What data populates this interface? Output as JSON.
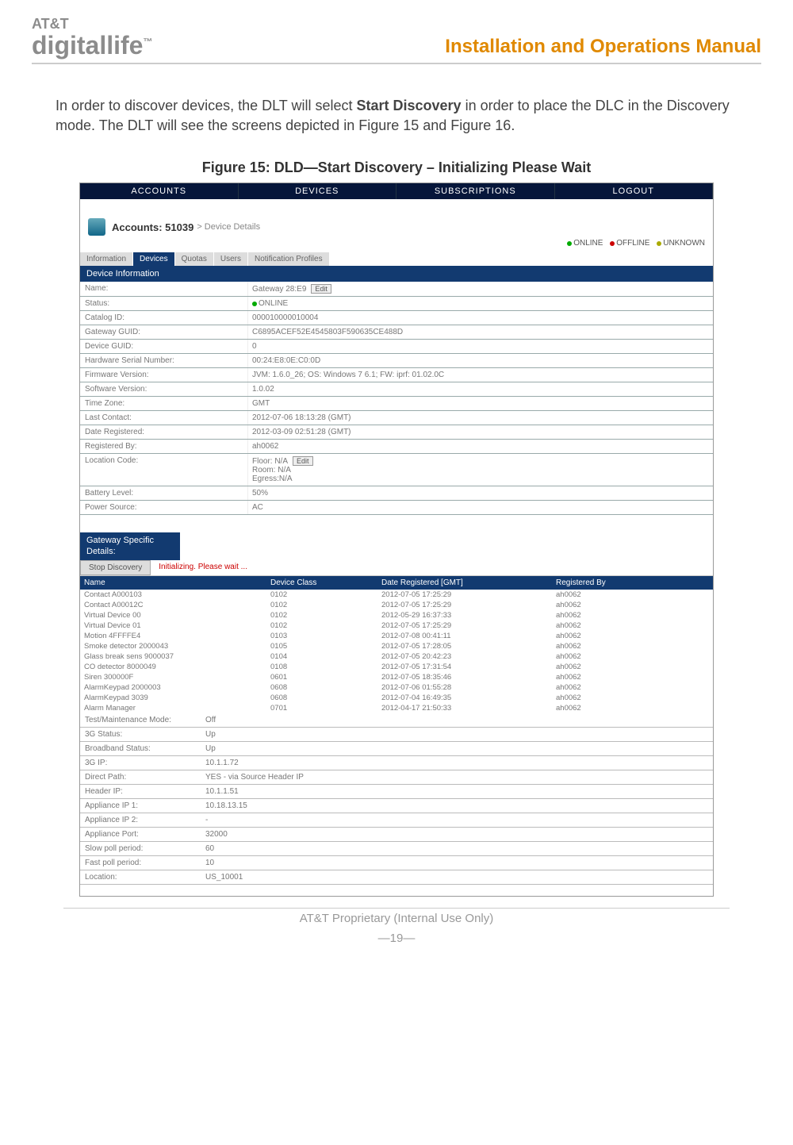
{
  "header": {
    "brand_top": "AT&T",
    "brand_main": "digitallife",
    "tm": "™",
    "doc_title": "Installation and Operations Manual"
  },
  "body": {
    "para_a": "In order to discover devices, the DLT will select ",
    "para_bold": "Start Discovery",
    "para_b": " in order to place the DLC in the Discovery mode. The DLT will see the screens depicted in Figure 15 and Figure 16."
  },
  "figure_caption": "Figure 15:  DLD—Start Discovery – Initializing Please Wait",
  "nav": {
    "accounts": "ACCOUNTS",
    "devices": "DEVICES",
    "subscriptions": "SUBSCRIPTIONS",
    "logout": "LOGOUT"
  },
  "subheader": {
    "label": "Accounts: 51039",
    "crumb": "> Device Details"
  },
  "status_legend": {
    "online": "ONLINE",
    "offline": "OFFLINE",
    "unknown": "UNKNOWN"
  },
  "tabs": {
    "information": "Information",
    "devices": "Devices",
    "quotas": "Quotas",
    "users": "Users",
    "notif": "Notification Profiles"
  },
  "section_device_info": "Device Information",
  "dev_rows": [
    {
      "label": "Name:",
      "value": "Gateway 28:E9",
      "edit": "Edit"
    },
    {
      "label": "Status:",
      "value": "ONLINE",
      "dot": true
    },
    {
      "label": "Catalog ID:",
      "value": "000010000010004"
    },
    {
      "label": "Gateway GUID:",
      "value": "C6895ACEF52E4545803F590635CE488D"
    },
    {
      "label": "Device GUID:",
      "value": "0"
    },
    {
      "label": "Hardware Serial Number:",
      "value": "00:24:E8:0E:C0:0D"
    },
    {
      "label": "Firmware Version:",
      "value": "JVM: 1.6.0_26; OS: Windows 7 6.1; FW: iprf: 01.02.0C"
    },
    {
      "label": "Software Version:",
      "value": "1.0.02"
    },
    {
      "label": "Time Zone:",
      "value": "GMT"
    },
    {
      "label": "Last Contact:",
      "value": "2012-07-06 18:13:28 (GMT)"
    },
    {
      "label": "Date Registered:",
      "value": "2012-03-09 02:51:28 (GMT)"
    },
    {
      "label": "Registered By:",
      "value": "ah0062"
    },
    {
      "label": "Location Code:",
      "value": "Floor:  N/A     Edit\nRoom:  N/A\nEgress:N/A",
      "edit": "Edit",
      "multi": true,
      "lines": [
        "Floor:  N/A",
        "Room:  N/A",
        "Egress:N/A"
      ]
    },
    {
      "label": "Battery Level:",
      "value": "50%"
    },
    {
      "label": "Power Source:",
      "value": "AC"
    }
  ],
  "section_gw": "Gateway Specific Details:",
  "stop_discovery": "Stop Discovery",
  "init_msg": "Initializing. Please wait ...",
  "table_head": {
    "name": "Name",
    "dclass": "Device Class",
    "date": "Date Registered [GMT]",
    "by": "Registered By"
  },
  "devices": [
    {
      "name": "Contact A000103",
      "dclass": "0102",
      "date": "2012-07-05 17:25:29",
      "by": "ah0062"
    },
    {
      "name": "Contact A00012C",
      "dclass": "0102",
      "date": "2012-07-05 17:25:29",
      "by": "ah0062"
    },
    {
      "name": "Virtual Device 00",
      "dclass": "0102",
      "date": "2012-05-29 16:37:33",
      "by": "ah0062"
    },
    {
      "name": "Virtual Device 01",
      "dclass": "0102",
      "date": "2012-07-05 17:25:29",
      "by": "ah0062"
    },
    {
      "name": "Motion 4FFFFE4",
      "dclass": "0103",
      "date": "2012-07-08 00:41:11",
      "by": "ah0062"
    },
    {
      "name": "Smoke detector 2000043",
      "dclass": "0105",
      "date": "2012-07-05 17:28:05",
      "by": "ah0062"
    },
    {
      "name": "Glass break sens 9000037",
      "dclass": "0104",
      "date": "2012-07-05 20:42:23",
      "by": "ah0062"
    },
    {
      "name": "CO detector 8000049",
      "dclass": "0108",
      "date": "2012-07-05 17:31:54",
      "by": "ah0062"
    },
    {
      "name": "Siren 300000F",
      "dclass": "0601",
      "date": "2012-07-05 18:35:46",
      "by": "ah0062"
    },
    {
      "name": "AlarmKeypad 2000003",
      "dclass": "0608",
      "date": "2012-07-06 01:55:28",
      "by": "ah0062"
    },
    {
      "name": "AlarmKeypad 3039",
      "dclass": "0608",
      "date": "2012-07-04 16:49:35",
      "by": "ah0062"
    },
    {
      "name": "Alarm Manager",
      "dclass": "0701",
      "date": "2012-04-17 21:50:33",
      "by": "ah0062"
    }
  ],
  "gw_rows": [
    {
      "label": "Test/Maintenance Mode:",
      "value": "Off"
    },
    {
      "label": "3G Status:",
      "value": "Up"
    },
    {
      "label": "Broadband Status:",
      "value": "Up"
    },
    {
      "label": "3G IP:",
      "value": "10.1.1.72"
    },
    {
      "label": "Direct Path:",
      "value": "YES - via Source Header IP"
    },
    {
      "label": "Header IP:",
      "value": "10.1.1.51"
    },
    {
      "label": "Appliance IP 1:",
      "value": "10.18.13.15"
    },
    {
      "label": "Appliance IP 2:",
      "value": "-"
    },
    {
      "label": "Appliance Port:",
      "value": "32000"
    },
    {
      "label": "Slow poll period:",
      "value": "60"
    },
    {
      "label": "Fast poll period:",
      "value": "10"
    },
    {
      "label": "Location:",
      "value": "US_10001"
    }
  ],
  "footer": {
    "prop": "AT&T Proprietary (Internal Use Only)",
    "page": "―19―"
  }
}
